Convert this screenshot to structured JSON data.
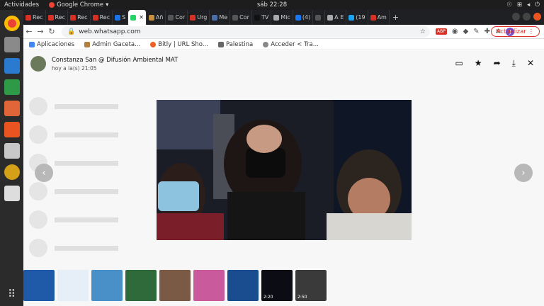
{
  "os": {
    "activities": "Actividades",
    "app_name": "Google Chrome",
    "clock": "sáb 22:28"
  },
  "tabs": [
    {
      "label": "Rec",
      "color": "#d93025"
    },
    {
      "label": "Rec",
      "color": "#d93025"
    },
    {
      "label": "Rec",
      "color": "#d93025"
    },
    {
      "label": "Rec",
      "color": "#d93025"
    },
    {
      "label": "S",
      "color": "#1a73e8"
    },
    {
      "label": "",
      "color": "#25d366",
      "active": true
    },
    {
      "label": "Añ",
      "color": "#c58f3e"
    },
    {
      "label": "Cor",
      "color": "#555555"
    },
    {
      "label": "Urg",
      "color": "#d93025"
    },
    {
      "label": "Me",
      "color": "#4a6ea9"
    },
    {
      "label": "Cor",
      "color": "#555555"
    },
    {
      "label": "TV",
      "color": "#111111"
    },
    {
      "label": "Mic",
      "color": "#aaaaaa"
    },
    {
      "label": "(4)",
      "color": "#1877f2"
    },
    {
      "label": "",
      "color": "#555555"
    },
    {
      "label": "A E",
      "color": "#aaaaaa"
    },
    {
      "label": "(19",
      "color": "#1da1f2"
    },
    {
      "label": "Am",
      "color": "#d93025"
    }
  ],
  "address": {
    "url": "web.whatsapp.com",
    "update_label": "Actualizar"
  },
  "bookmarks": [
    "Aplicaciones",
    "Admin Gaceta...",
    "Bitly | URL Sho...",
    "Palestina",
    "Acceder < Tra..."
  ],
  "viewer": {
    "sender_name": "Constanza San @ Difusión Ambiental MAT",
    "timestamp": "hoy a la(s) 21:05",
    "prev_arrow": "‹",
    "next_arrow": "›"
  },
  "thumbnails": [
    {
      "color": "#1e5aa8",
      "duration": ""
    },
    {
      "color": "#e6eef7",
      "duration": ""
    },
    {
      "color": "#4a90c8",
      "duration": ""
    },
    {
      "color": "#2f6b3a",
      "duration": ""
    },
    {
      "color": "#7a5a44",
      "duration": ""
    },
    {
      "color": "#c95a9b",
      "duration": ""
    },
    {
      "color": "#1a4d8f",
      "duration": ""
    },
    {
      "color": "#0c0c14",
      "duration": "2:20"
    },
    {
      "color": "#3a3a3a",
      "duration": "2:50"
    }
  ]
}
